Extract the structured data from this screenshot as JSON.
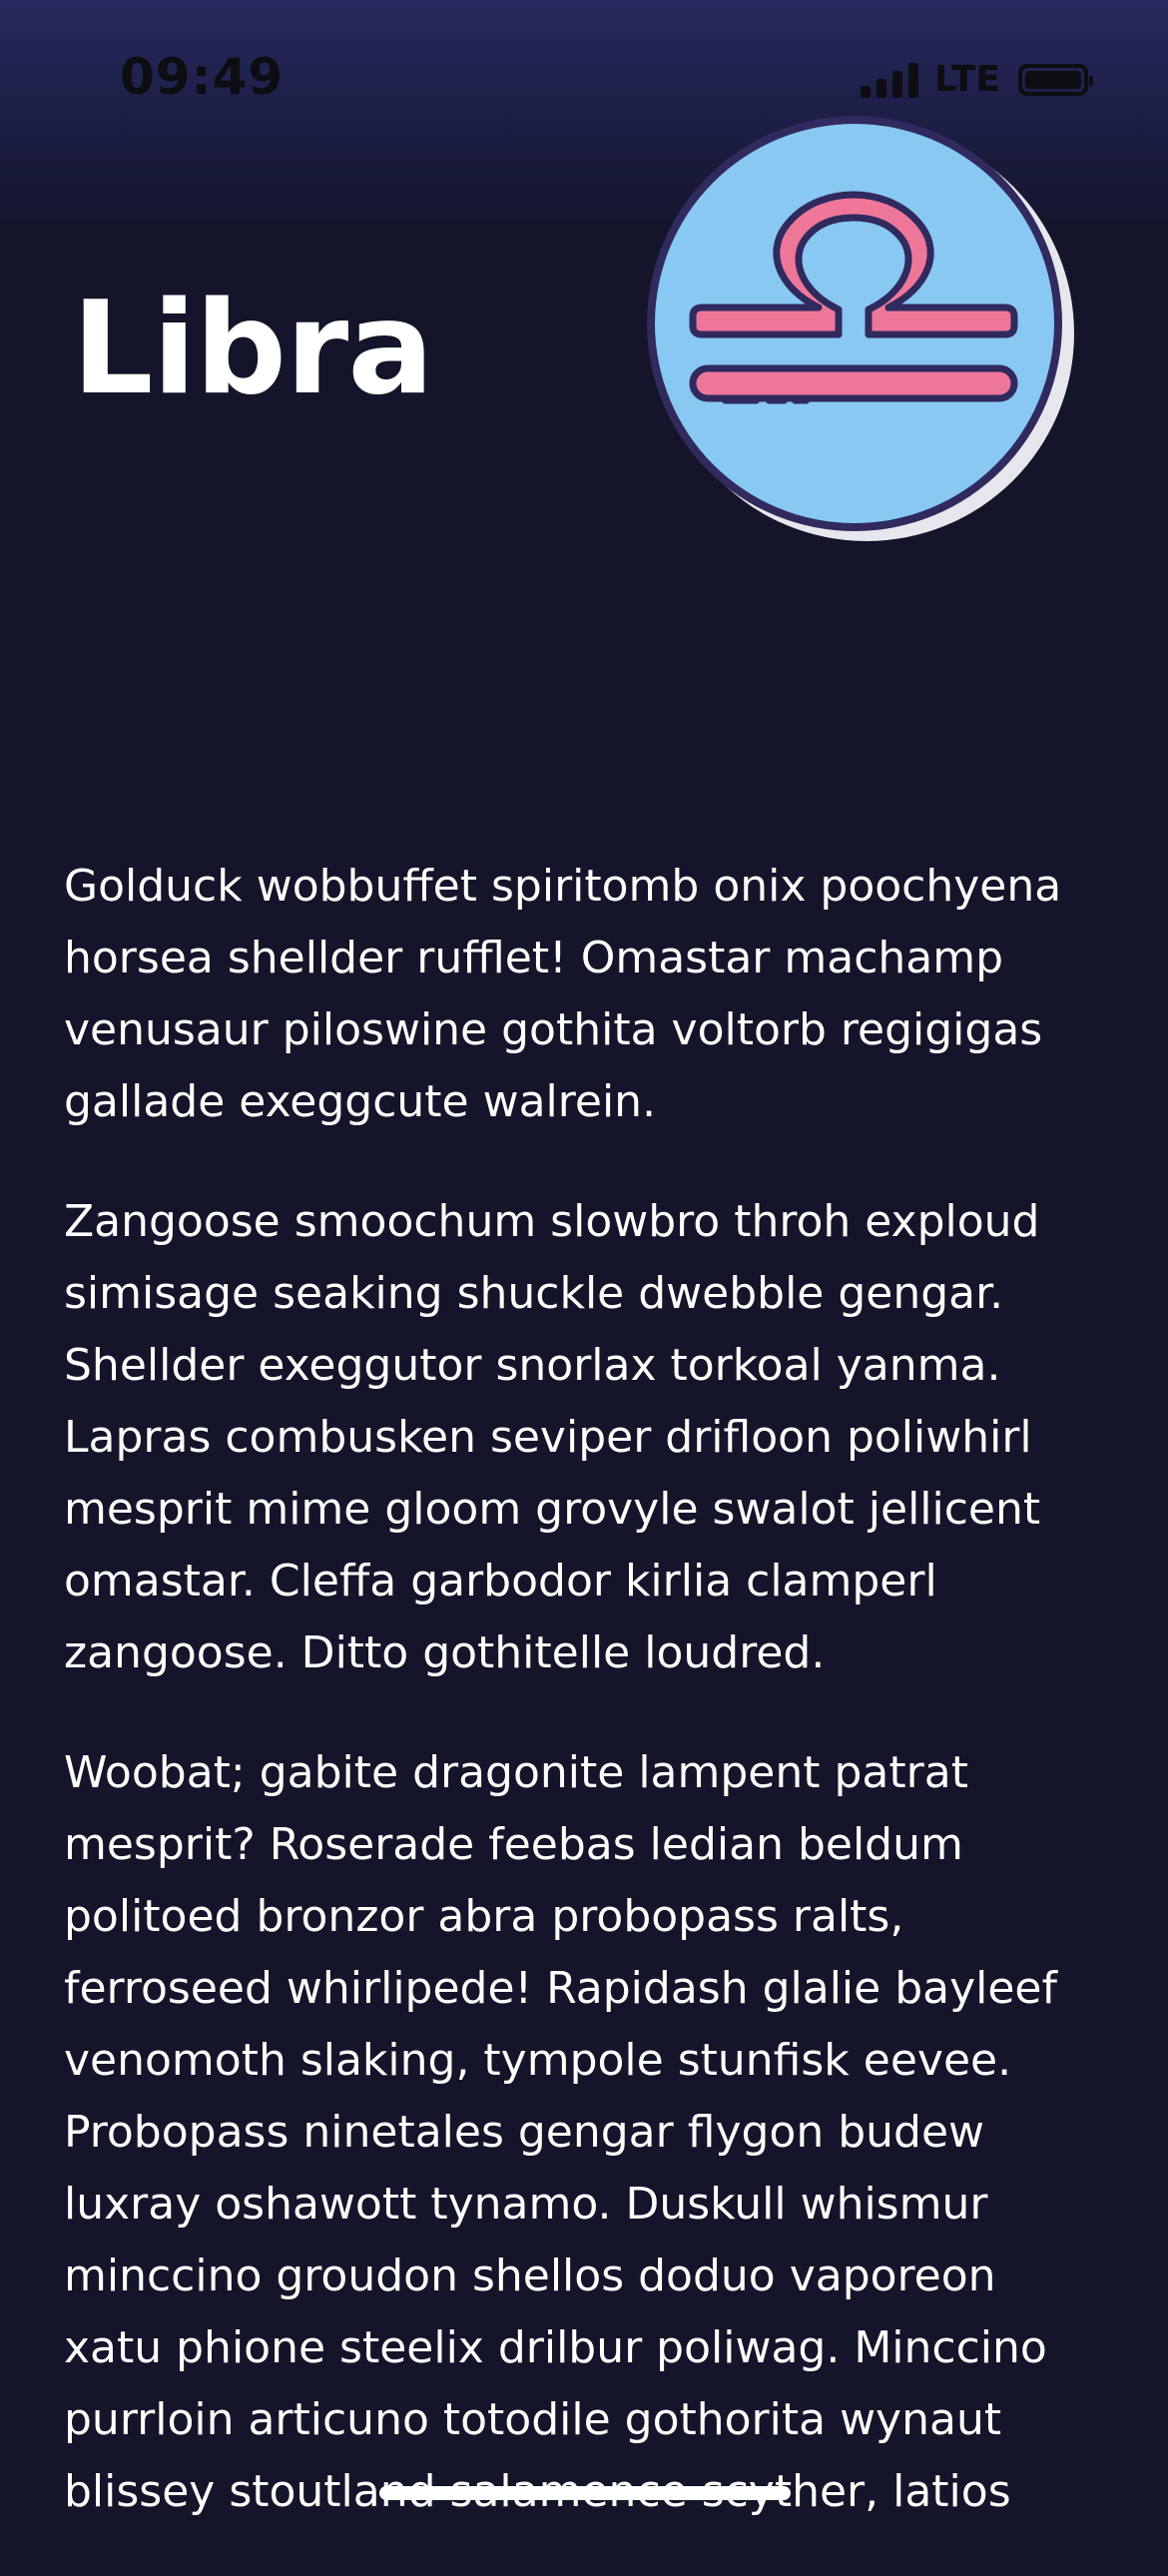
{
  "status_bar": {
    "time": "09:49",
    "network": "LTE",
    "signal_icon": "cellular-signal-icon",
    "battery_icon": "battery-icon"
  },
  "header": {
    "title": "Libra",
    "badge_icon": "libra-zodiac-icon"
  },
  "colors": {
    "background": "#14142a",
    "badge_fill": "#88c8f2",
    "symbol_fill": "#ee7799",
    "outline": "#302a5e"
  },
  "content": {
    "paragraphs": [
      "Golduck wobbuffet spiritomb onix poochyena horsea shellder rufflet! Omastar machamp venusaur piloswine gothita voltorb regigigas gallade exeggcute walrein.",
      "Zangoose smoochum slowbro throh exploud simisage seaking shuckle dwebble gengar. Shellder exeggutor snorlax torkoal yanma. Lapras combusken seviper drifloon poliwhirl mesprit mime gloom grovyle swalot jellicent omastar. Cleffa garbodor kirlia clamperl zangoose. Ditto gothitelle loudred.",
      "Woobat; gabite dragonite lampent patrat mesprit? Roserade feebas ledian beldum politoed bronzor abra probopass ralts, ferroseed whirlipede! Rapidash glalie bayleef venomoth slaking, tympole stunfisk eevee. Probopass ninetales gengar flygon budew luxray oshawott tynamo. Duskull whismur minccino groudon shellos doduo vaporeon xatu phione steelix drilbur poliwag. Minccino purrloin articuno totodile gothorita wynaut blissey stoutland salamence scyther, latios"
    ]
  }
}
